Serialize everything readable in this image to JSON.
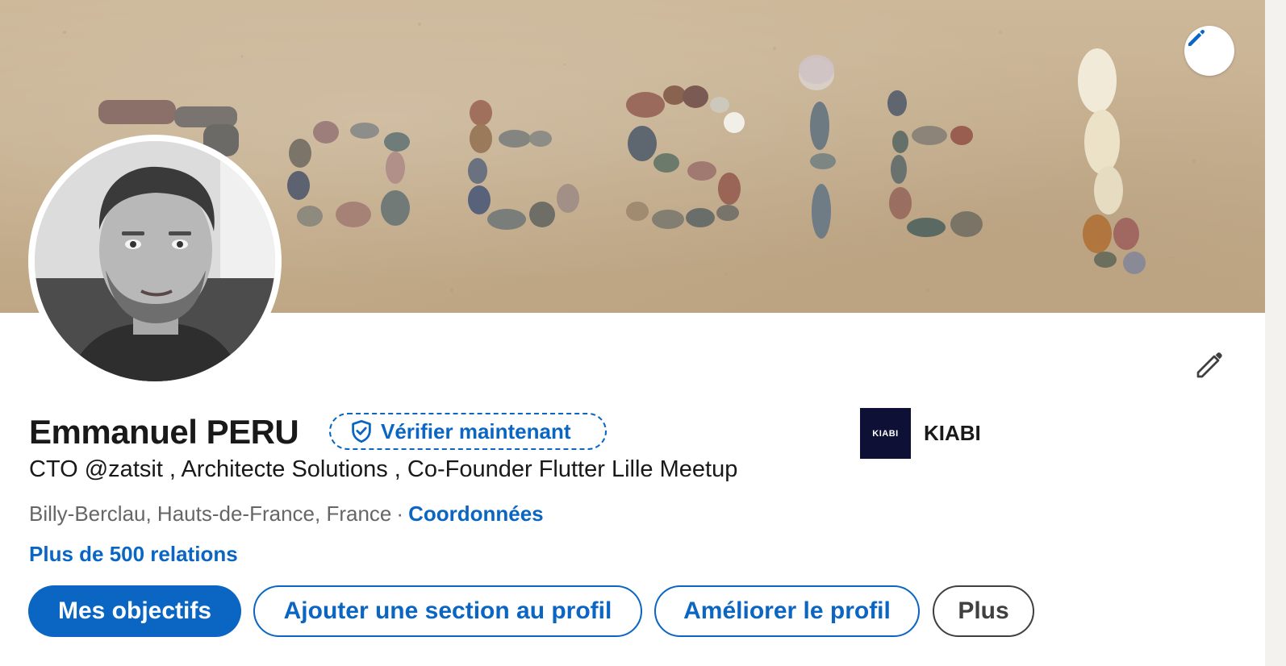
{
  "banner": {
    "text_on_sand": "zatsit!"
  },
  "profile": {
    "name": "Emmanuel PERU",
    "verify_label": "Vérifier maintenant",
    "headline": "CTO @zatsit , Architecte Solutions , Co-Founder Flutter Lille Meetup",
    "location": "Billy-Berclau, Hauts-de-France, France",
    "separator": "·",
    "contact_label": "Coordonnées",
    "connections_label": "Plus de 500 relations"
  },
  "company": {
    "logo_text": "KIABI",
    "name": "KIABI"
  },
  "actions": {
    "primary_label": "Mes objectifs",
    "add_section_label": "Ajouter une section au profil",
    "improve_label": "Améliorer le profil",
    "more_label": "Plus"
  },
  "colors": {
    "accent": "#0a66c2",
    "text": "#191919",
    "secondary_text": "#666666",
    "company_logo_bg": "#0f1035"
  }
}
